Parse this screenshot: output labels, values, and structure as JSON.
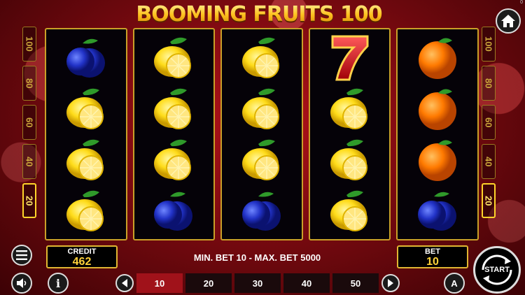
{
  "title": "BOOMING FRUITS 100",
  "version": "0",
  "paytable_left": [
    "100",
    "80",
    "60",
    "40",
    "20"
  ],
  "paytable_right": [
    "100",
    "80",
    "60",
    "40",
    "20"
  ],
  "active_line": "20",
  "reels": [
    [
      "plum",
      "lemon",
      "lemon",
      "lemon"
    ],
    [
      "lemon",
      "lemon",
      "lemon",
      "plum"
    ],
    [
      "lemon",
      "lemon",
      "lemon",
      "plum"
    ],
    [
      "seven",
      "lemon",
      "lemon",
      "lemon"
    ],
    [
      "orange",
      "orange",
      "orange",
      "plum"
    ]
  ],
  "credit": {
    "label": "CREDIT",
    "value": "462"
  },
  "bet": {
    "label": "BET",
    "value": "10"
  },
  "limits": "MIN. BET 10 - MAX. BET 5000",
  "bet_options": [
    "10",
    "20",
    "30",
    "40",
    "50"
  ],
  "selected_bet": "10",
  "start_label": "START",
  "auto_label": "A",
  "info_label": "i",
  "colors": {
    "reel_border": "#c9a028",
    "selected_bet": "#a0121a",
    "value": "#ffd23a"
  }
}
